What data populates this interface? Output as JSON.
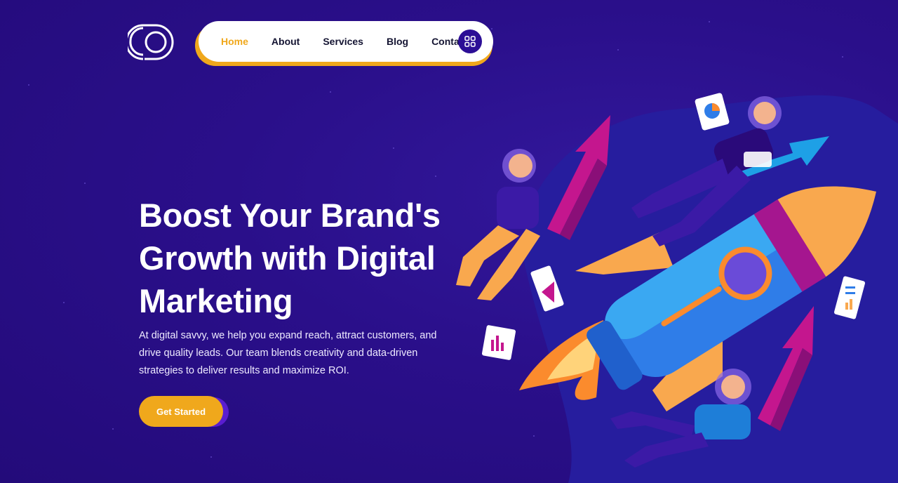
{
  "nav": {
    "items": [
      {
        "label": "Home",
        "active": true
      },
      {
        "label": "About",
        "active": false
      },
      {
        "label": "Services",
        "active": false
      },
      {
        "label": "Blog",
        "active": false
      },
      {
        "label": "Contact",
        "active": false
      }
    ],
    "menu_icon": "grid-icon"
  },
  "hero": {
    "title_lines": [
      "Boost Your Brand's",
      "Growth with Digital",
      "Marketing"
    ],
    "description": "At digital savvy, we help you expand reach, attract customers, and drive quality leads. Our team blends creativity and data-driven strategies to deliver results and maximize ROI.",
    "cta_label": "Get Started"
  },
  "colors": {
    "background": "#2a0f8a",
    "accent": "#f0a81c",
    "nav_bg": "#ffffff",
    "text": "#ffffff"
  },
  "icons": [
    "logo-mark",
    "grid-icon",
    "rocket-illustration"
  ]
}
